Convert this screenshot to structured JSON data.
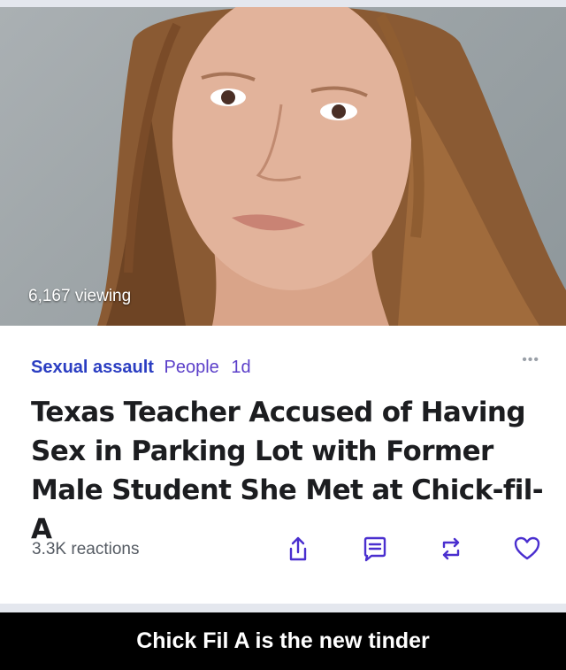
{
  "image": {
    "viewing_label": "6,167 viewing"
  },
  "article": {
    "topic": "Sexual assault",
    "source": "People",
    "age": "1d",
    "more_label": "•••",
    "headline": "Texas Teacher Accused of Having Sex in Parking Lot with Former Male Student She Met at Chick-fil-A",
    "reactions": "3.3K reactions"
  },
  "actions": [
    {
      "name": "share-icon"
    },
    {
      "name": "comment-icon"
    },
    {
      "name": "repost-icon"
    },
    {
      "name": "heart-icon"
    }
  ],
  "caption": "Chick Fil A is the new tinder",
  "colors": {
    "topic": "#2b3ec2",
    "source": "#5b3fc9",
    "icon": "#4a2fcf"
  }
}
